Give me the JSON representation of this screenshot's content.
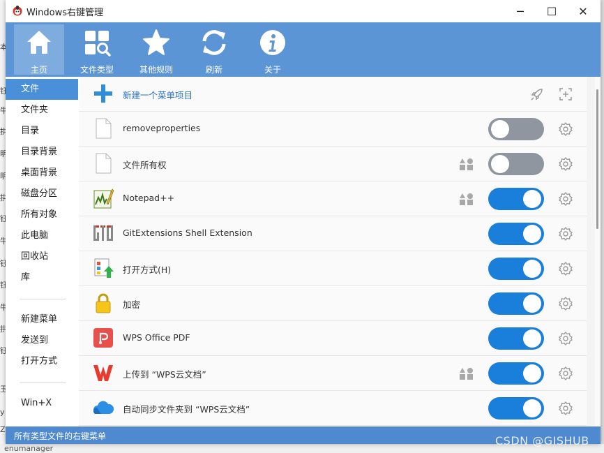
{
  "window": {
    "title": "Windows右键管理",
    "controls": {
      "minimize": "─",
      "maximize": "☐",
      "close": "✕"
    }
  },
  "toolbar": {
    "items": [
      {
        "label": "主页",
        "icon": "home-icon"
      },
      {
        "label": "文件类型",
        "icon": "file-types-icon"
      },
      {
        "label": "其他规则",
        "icon": "star-icon"
      },
      {
        "label": "刷新",
        "icon": "refresh-icon"
      },
      {
        "label": "关于",
        "icon": "info-icon"
      }
    ],
    "active": "主页",
    "color": "#5b95d6"
  },
  "sidebar": {
    "groups": [
      [
        "文件",
        "文件夹",
        "目录",
        "目录背景",
        "桌面背景",
        "磁盘分区",
        "所有对象",
        "此电脑",
        "回收站",
        "库"
      ],
      [
        "新建菜单",
        "发送到",
        "打开方式"
      ],
      [
        "Win+X"
      ]
    ],
    "active": "文件"
  },
  "list": {
    "new_item": "新建一个菜单项目",
    "rows": [
      {
        "name": "removeproperties",
        "enabled": false,
        "icon": "blank-file-icon"
      },
      {
        "name": "文件所有权",
        "enabled": false,
        "icon": "blank-file-icon",
        "shapes": true
      },
      {
        "name": "Notepad++",
        "enabled": true,
        "icon": "notepad-plus-plus-icon",
        "shapes": true
      },
      {
        "name": "GitExtensions Shell Extension",
        "enabled": true,
        "icon": "git-extensions-icon"
      },
      {
        "name": "打开方式(H)",
        "enabled": true,
        "icon": "open-with-icon"
      },
      {
        "name": "加密",
        "enabled": true,
        "icon": "lock-icon"
      },
      {
        "name": "WPS Office PDF",
        "enabled": true,
        "icon": "wps-pdf-icon"
      },
      {
        "name": "上传到 “WPS云文档”",
        "enabled": true,
        "icon": "wps-office-icon",
        "shapes": true
      },
      {
        "name": "自动同步文件夹到 “WPS云文档”",
        "enabled": true,
        "icon": "cloud-icon"
      }
    ]
  },
  "status": {
    "text": "所有类型文件的右键菜单"
  },
  "watermark": "CSDN @GISHUB",
  "background_fragments": {
    "left": [
      "本",
      "钰",
      "牛",
      "拱",
      "明",
      "明",
      "拱",
      "钰",
      "牛",
      "钰",
      "钰",
      "牛",
      "拱",
      "钰",
      "玉",
      "y",
      "Z"
    ],
    "bottom": "enumanager"
  }
}
